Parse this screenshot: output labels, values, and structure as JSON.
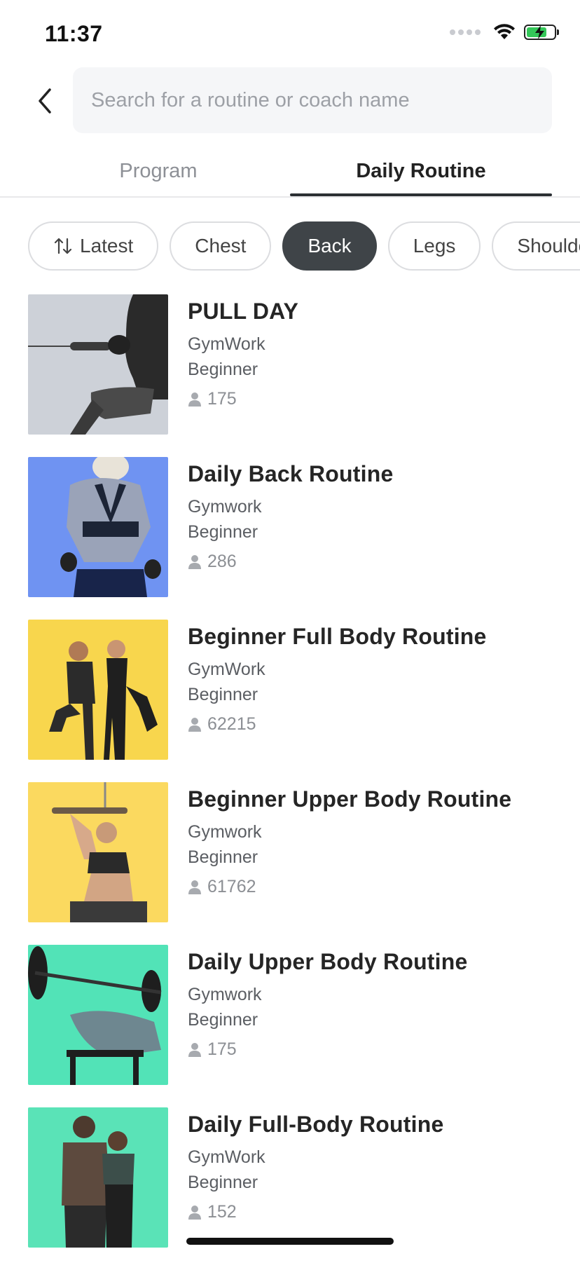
{
  "status_bar": {
    "time": "11:37",
    "icons": [
      "signal-dots-icon",
      "wifi-icon",
      "battery-charging-icon"
    ],
    "battery_color": "#34c759"
  },
  "search": {
    "placeholder": "Search for a routine or coach name",
    "value": ""
  },
  "tabs": [
    {
      "label": "Program",
      "active": false
    },
    {
      "label": "Daily Routine",
      "active": true
    }
  ],
  "filters": [
    {
      "label": "Latest",
      "icon": "sort-icon",
      "active": false
    },
    {
      "label": "Chest",
      "active": false
    },
    {
      "label": "Back",
      "active": true
    },
    {
      "label": "Legs",
      "active": false
    },
    {
      "label": "Shoulde",
      "active": false
    }
  ],
  "routines": [
    {
      "title": "PULL DAY",
      "coach": "GymWork",
      "level": "Beginner",
      "count": "175",
      "image_bg": "#cdd1d8"
    },
    {
      "title": "Daily Back Routine",
      "coach": "Gymwork",
      "level": "Beginner",
      "count": "286",
      "image_bg": "#6f93f2"
    },
    {
      "title": "Beginner Full Body Routine",
      "coach": "GymWork",
      "level": "Beginner",
      "count": "62215",
      "image_bg": "#f8d64d"
    },
    {
      "title": "Beginner Upper Body Routine",
      "coach": "Gymwork",
      "level": "Beginner",
      "count": "61762",
      "image_bg": "#fbd95f"
    },
    {
      "title": "Daily Upper Body Routine",
      "coach": "Gymwork",
      "level": "Beginner",
      "count": "175",
      "image_bg": "#52e3b7"
    },
    {
      "title": "Daily Full-Body Routine",
      "coach": "GymWork",
      "level": "Beginner",
      "count": "152",
      "image_bg": "#5ae3b7"
    }
  ],
  "colors": {
    "active_chip": "#3f4448",
    "tab_underline": "#2b2f33",
    "muted_text": "#8c8f94"
  }
}
